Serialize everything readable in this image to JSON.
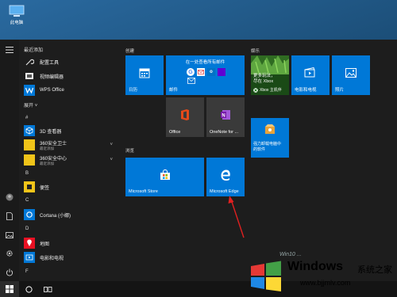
{
  "desktop": {
    "icon_label": "此电脑"
  },
  "start_menu": {
    "recently_added_title": "最近添加",
    "recent_apps": [
      {
        "name": "配置工具"
      },
      {
        "name": "视频编辑器"
      },
      {
        "name": "WPS Office"
      }
    ],
    "expand_label": "展开",
    "letters": {
      "hash": "#",
      "b": "B",
      "c": "C",
      "d": "D",
      "f": "F"
    },
    "apps": [
      {
        "name": "3D 查看器"
      },
      {
        "name": "360安全卫士",
        "sub": "最近添加"
      },
      {
        "name": "360安全中心",
        "sub": "最近添加"
      },
      {
        "name": "便签"
      },
      {
        "name": "Cortana (小娜)"
      },
      {
        "name": "地图"
      },
      {
        "name": "电影和电视"
      }
    ]
  },
  "groups": {
    "create": "创建",
    "browse": "浏览",
    "play": "娱乐"
  },
  "tiles": {
    "calendar": "日历",
    "mail_header": "在一处查看所有邮件",
    "mail": "邮件",
    "office": "Office",
    "onenote": "OneNote for ...",
    "store": "Microsoft Store",
    "edge": "Microsoft Edge",
    "xbox_line1": "更多玩法，",
    "xbox_line2": "尽在 Xbox",
    "xbox_brand": "Xbox 主机伴",
    "movies": "电影和电视",
    "photos": "照片",
    "paint3d_line1": "强力卸载电脑中",
    "paint3d_line2": "的软件"
  },
  "watermark": {
    "windows": "Windows",
    "cn": "系统之家",
    "url": "www.bjjmlv.com",
    "signature": "Win10 ..."
  },
  "colors": {
    "tile_blue": "#0078d7",
    "menu_bg": "#1d1d1d",
    "xbox_green": "#107c10",
    "arrow_red": "#e02020"
  }
}
